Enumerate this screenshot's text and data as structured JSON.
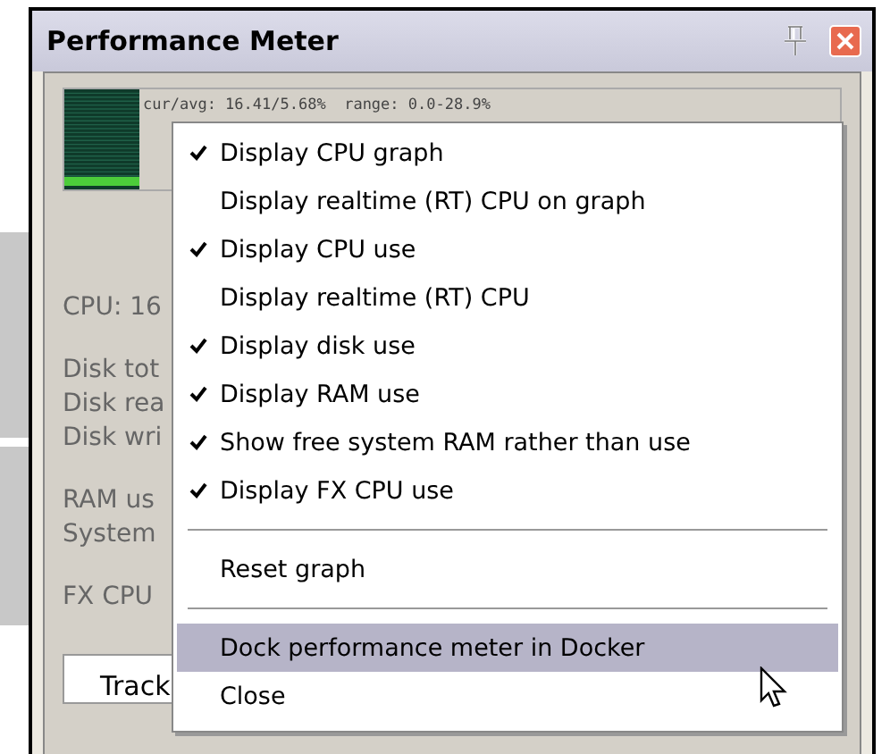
{
  "window": {
    "title": "Performance Meter"
  },
  "graph": {
    "readout": "cur/avg: 16.41/5.68%  range: 0.0-28.9%"
  },
  "stats": [
    [
      "CPU: 16"
    ],
    [
      "Disk tot",
      "Disk rea",
      "Disk wri"
    ],
    [
      "RAM us",
      "System"
    ],
    [
      "FX CPU"
    ]
  ],
  "table": {
    "columns": [
      "Track"
    ]
  },
  "context_menu": {
    "items": [
      {
        "kind": "check",
        "label": "Display CPU graph",
        "checked": true,
        "selected": false
      },
      {
        "kind": "check",
        "label": "Display realtime (RT) CPU on graph",
        "checked": false,
        "selected": false
      },
      {
        "kind": "check",
        "label": "Display CPU use",
        "checked": true,
        "selected": false
      },
      {
        "kind": "check",
        "label": "Display realtime (RT) CPU",
        "checked": false,
        "selected": false
      },
      {
        "kind": "check",
        "label": "Display disk use",
        "checked": true,
        "selected": false
      },
      {
        "kind": "check",
        "label": "Display RAM use",
        "checked": true,
        "selected": false
      },
      {
        "kind": "check",
        "label": "Show free system RAM rather than use",
        "checked": true,
        "selected": false
      },
      {
        "kind": "check",
        "label": "Display FX CPU use",
        "checked": true,
        "selected": false
      },
      {
        "kind": "separator"
      },
      {
        "kind": "check",
        "label": "Reset graph",
        "checked": false,
        "selected": false
      },
      {
        "kind": "separator"
      },
      {
        "kind": "check",
        "label": "Dock performance meter in Docker",
        "checked": false,
        "selected": true
      },
      {
        "kind": "check",
        "label": "Close",
        "checked": false,
        "selected": false
      }
    ]
  }
}
